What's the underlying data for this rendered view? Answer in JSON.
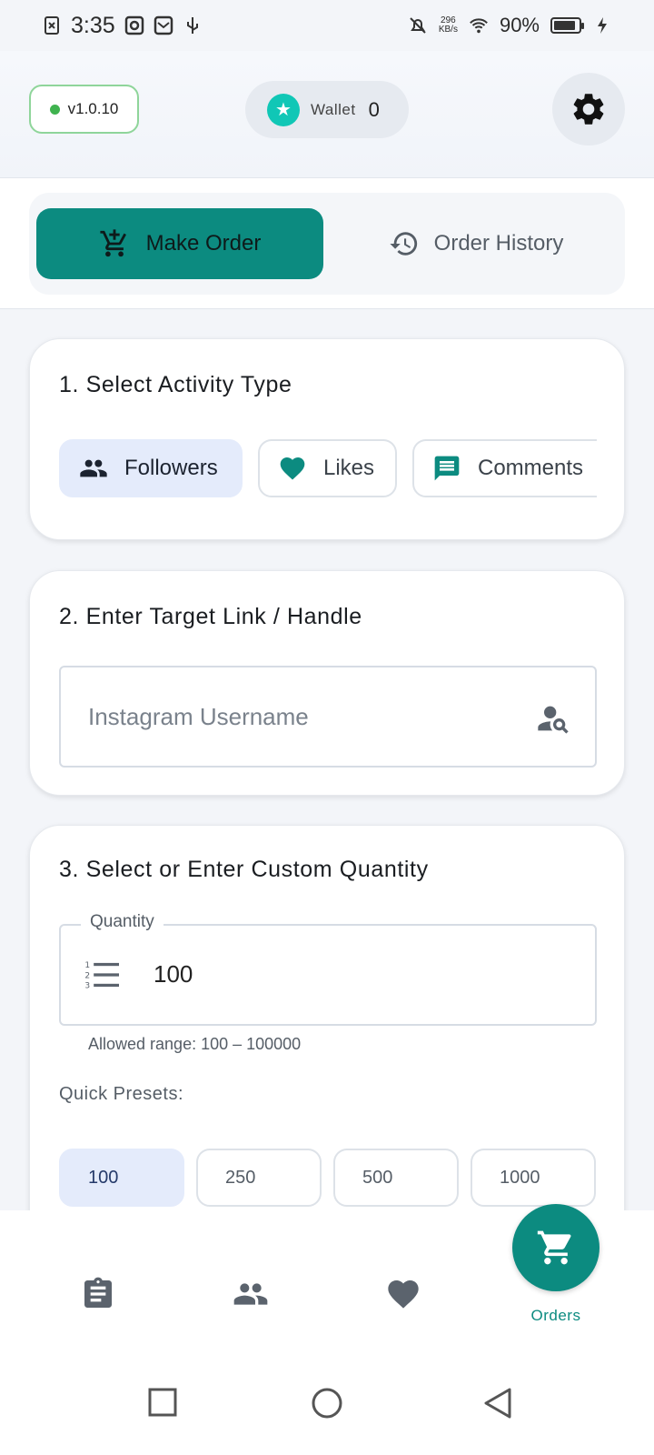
{
  "status_bar": {
    "time": "3:35",
    "net_speed_value": "296",
    "net_speed_unit": "KB/s",
    "battery_percent": "90%",
    "battery_level": 0.9
  },
  "header": {
    "version": "v1.0.10",
    "wallet_label": "Wallet",
    "wallet_value": "0"
  },
  "tabs": {
    "make_order": "Make Order",
    "order_history": "Order History",
    "active": "Make Order"
  },
  "section1": {
    "title": "1. Select Activity Type",
    "options": [
      "Followers",
      "Likes",
      "Comments"
    ],
    "selected": "Followers"
  },
  "section2": {
    "title": "2. Enter Target Link / Handle",
    "placeholder": "Instagram Username",
    "value": ""
  },
  "section3": {
    "title": "3. Select or Enter Custom Quantity",
    "quantity_label": "Quantity",
    "quantity_value": "100",
    "helper": "Allowed range: 100 – 100000",
    "presets_label": "Quick Presets:",
    "presets": [
      "100",
      "250",
      "500",
      "1000"
    ],
    "selected_preset": "100"
  },
  "bottom_nav": {
    "orders_label": "Orders",
    "items": [
      "clipboard-icon",
      "people-icon",
      "heart-icon",
      "cart-icon"
    ]
  },
  "colors": {
    "accent": "#0c8b80",
    "selected_chip": "#e4ebfb",
    "status_green": "#3fb34f",
    "wallet_star": "#10c7b6"
  }
}
